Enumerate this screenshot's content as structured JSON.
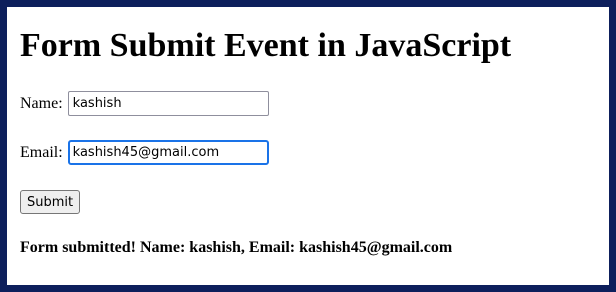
{
  "page": {
    "title": "Form Submit Event in JavaScript"
  },
  "form": {
    "name_label": "Name:",
    "name_value": "kashish",
    "email_label": "Email:",
    "email_value": "kashish45@gmail.com",
    "submit_label": "Submit"
  },
  "result": {
    "message": "Form submitted! Name: kashish, Email: kashish45@gmail.com"
  },
  "colors": {
    "frame_border": "#0d1f5c",
    "focus_ring": "#1a73e8"
  }
}
